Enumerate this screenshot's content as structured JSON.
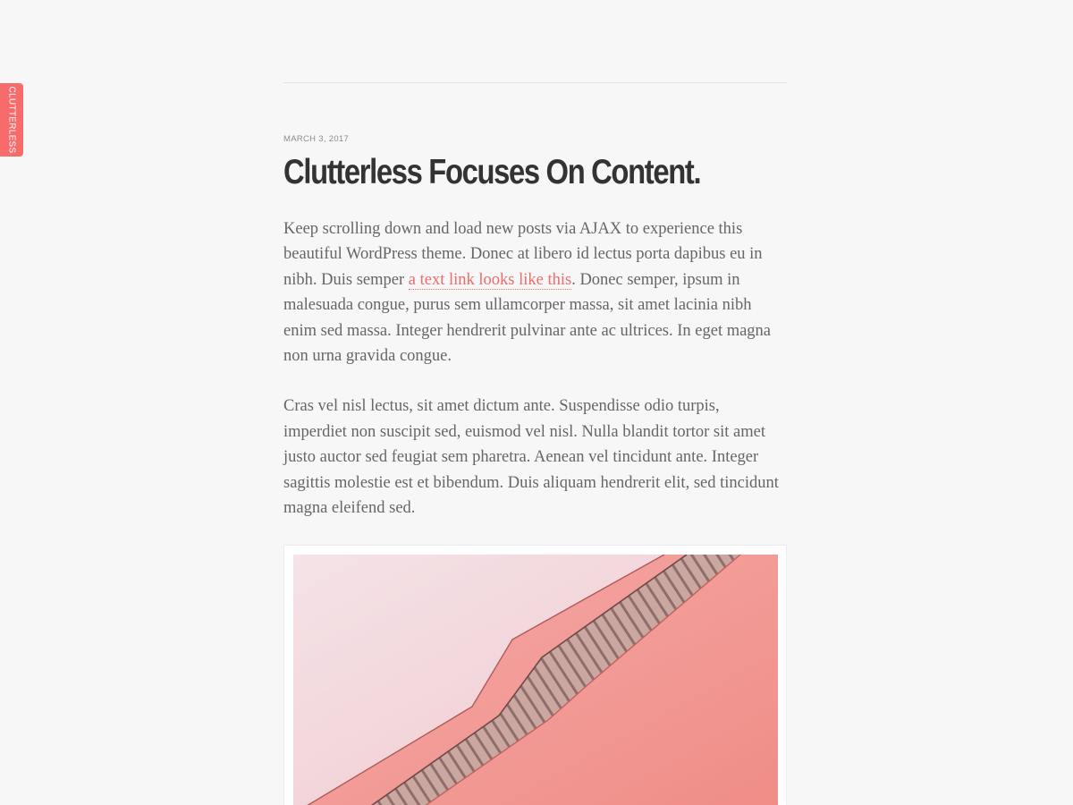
{
  "side_tab": {
    "label": "Clutterless"
  },
  "post": {
    "date": "March 3, 2017",
    "title": "Clutterless Focuses On Content.",
    "paragraph1": {
      "before_link": "Keep scrolling down and load new posts via AJAX to experience this beautiful WordPress theme. Donec at libero id lectus porta dapibus eu in nibh. Duis semper ",
      "link_text": "a text link looks like this",
      "after_link": ". Donec semper, ipsum in malesuada congue, purus sem ullamcorper massa, sit amet lacinia nibh enim sed massa. Integer hendrerit pulvinar ante ac ultrices. In eget magna non urna gravida congue."
    },
    "paragraph2": "Cras vel nisl lectus, sit amet dictum ante. Suspendisse odio turpis, imperdiet non suscipit sed, euismod vel nisl. Nulla blandit tortor sit amet justo auctor sed feugiat sem pharetra. Aenean vel tincidunt ante. Integer sagittis molestie est et bibendum. Duis aliquam hendrerit elit, sed tincidunt magna eleifend sed."
  },
  "colors": {
    "accent": "#f76b6b",
    "background": "#f7f7f7",
    "title": "#333333",
    "body_text": "#666666"
  }
}
